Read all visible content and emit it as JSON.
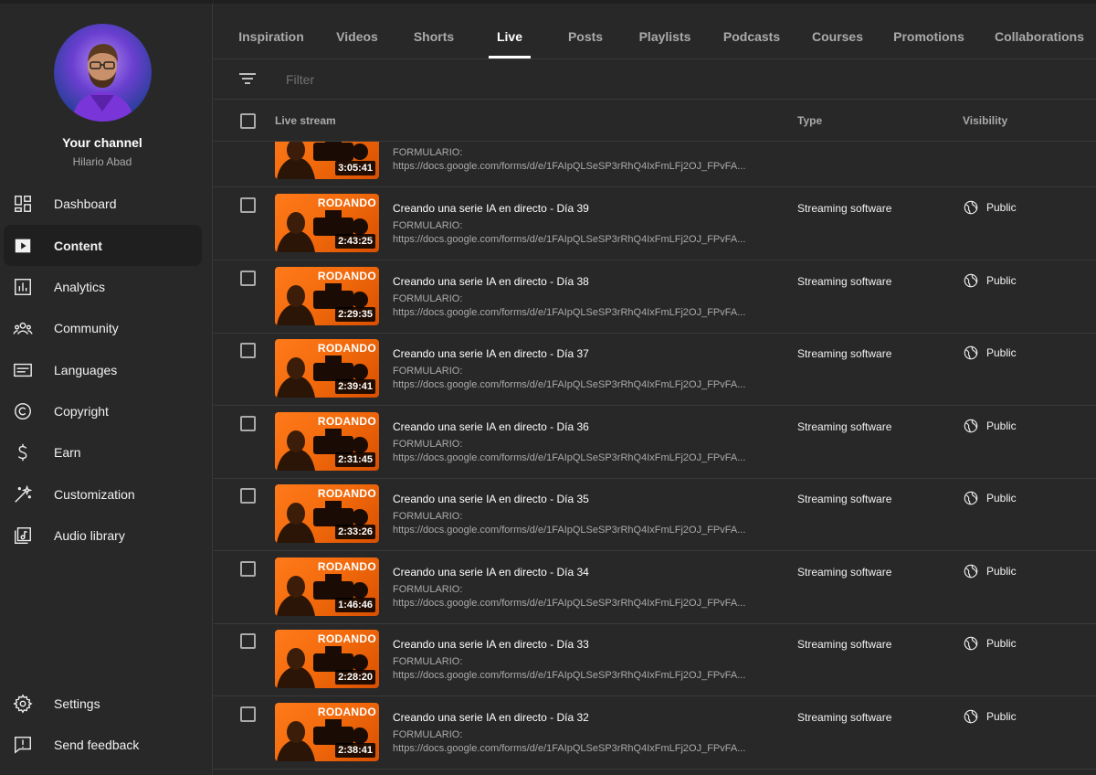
{
  "sidebar": {
    "channel_title": "Your channel",
    "channel_name": "Hilario Abad",
    "items": [
      {
        "label": "Dashboard",
        "icon": "dashboard-icon"
      },
      {
        "label": "Content",
        "icon": "content-icon",
        "active": true
      },
      {
        "label": "Analytics",
        "icon": "analytics-icon"
      },
      {
        "label": "Community",
        "icon": "community-icon"
      },
      {
        "label": "Languages",
        "icon": "languages-icon"
      },
      {
        "label": "Copyright",
        "icon": "copyright-icon"
      },
      {
        "label": "Earn",
        "icon": "earn-icon"
      },
      {
        "label": "Customization",
        "icon": "customization-icon"
      },
      {
        "label": "Audio library",
        "icon": "audio-library-icon"
      }
    ],
    "bottom_items": [
      {
        "label": "Settings",
        "icon": "gear-icon"
      },
      {
        "label": "Send feedback",
        "icon": "feedback-icon"
      }
    ]
  },
  "tabs": [
    {
      "label": "Inspiration"
    },
    {
      "label": "Videos"
    },
    {
      "label": "Shorts"
    },
    {
      "label": "Live",
      "active": true
    },
    {
      "label": "Posts"
    },
    {
      "label": "Playlists"
    },
    {
      "label": "Podcasts"
    },
    {
      "label": "Courses"
    },
    {
      "label": "Promotions"
    },
    {
      "label": "Collaborations"
    }
  ],
  "filter": {
    "placeholder": "Filter"
  },
  "table": {
    "headers": {
      "stream": "Live stream",
      "type": "Type",
      "visibility": "Visibility"
    },
    "partial_row": {
      "duration": "3:05:41",
      "desc1": "FORMULARIO:",
      "desc2": "https://docs.google.com/forms/d/e/1FAIpQLSeSP3rRhQ4IxFmLFj2OJ_FPvFA..."
    },
    "rows": [
      {
        "title": "Creando una serie IA en directo - Día 39",
        "duration": "2:43:25",
        "badge": "RODANDO",
        "desc1": "FORMULARIO:",
        "desc2": "https://docs.google.com/forms/d/e/1FAIpQLSeSP3rRhQ4IxFmLFj2OJ_FPvFA...",
        "type": "Streaming software",
        "visibility": "Public"
      },
      {
        "title": "Creando una serie IA en directo - Día 38",
        "duration": "2:29:35",
        "badge": "RODANDO",
        "desc1": "FORMULARIO:",
        "desc2": "https://docs.google.com/forms/d/e/1FAIpQLSeSP3rRhQ4IxFmLFj2OJ_FPvFA...",
        "type": "Streaming software",
        "visibility": "Public"
      },
      {
        "title": "Creando una serie IA en directo - Día 37",
        "duration": "2:39:41",
        "badge": "RODANDO",
        "desc1": "FORMULARIO:",
        "desc2": "https://docs.google.com/forms/d/e/1FAIpQLSeSP3rRhQ4IxFmLFj2OJ_FPvFA...",
        "type": "Streaming software",
        "visibility": "Public"
      },
      {
        "title": "Creando una serie IA en directo - Día 36",
        "duration": "2:31:45",
        "badge": "RODANDO",
        "desc1": "FORMULARIO:",
        "desc2": "https://docs.google.com/forms/d/e/1FAIpQLSeSP3rRhQ4IxFmLFj2OJ_FPvFA...",
        "type": "Streaming software",
        "visibility": "Public"
      },
      {
        "title": "Creando una serie IA en directo - Día 35",
        "duration": "2:33:26",
        "badge": "RODANDO",
        "desc1": "FORMULARIO:",
        "desc2": "https://docs.google.com/forms/d/e/1FAIpQLSeSP3rRhQ4IxFmLFj2OJ_FPvFA...",
        "type": "Streaming software",
        "visibility": "Public"
      },
      {
        "title": "Creando una serie IA en directo - Día 34",
        "duration": "1:46:46",
        "badge": "RODANDO",
        "desc1": "FORMULARIO:",
        "desc2": "https://docs.google.com/forms/d/e/1FAIpQLSeSP3rRhQ4IxFmLFj2OJ_FPvFA...",
        "type": "Streaming software",
        "visibility": "Public"
      },
      {
        "title": "Creando una serie IA en directo - Día 33",
        "duration": "2:28:20",
        "badge": "RODANDO",
        "desc1": "FORMULARIO:",
        "desc2": "https://docs.google.com/forms/d/e/1FAIpQLSeSP3rRhQ4IxFmLFj2OJ_FPvFA...",
        "type": "Streaming software",
        "visibility": "Public"
      },
      {
        "title": "Creando una serie IA en directo - Día 32",
        "duration": "2:38:41",
        "badge": "RODANDO",
        "desc1": "FORMULARIO:",
        "desc2": "https://docs.google.com/forms/d/e/1FAIpQLSeSP3rRhQ4IxFmLFj2OJ_FPvFA...",
        "type": "Streaming software",
        "visibility": "Public"
      }
    ]
  },
  "colors": {
    "background": "#282828",
    "thumb_orange": "#f26a0c",
    "active_nav": "#1f1f1f",
    "muted_text": "#aaaaaa"
  }
}
